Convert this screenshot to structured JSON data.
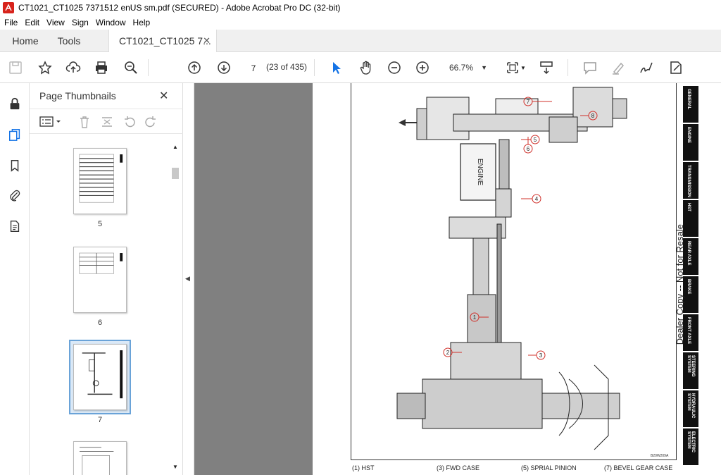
{
  "window": {
    "title": "CT1021_CT1025 7371512 enUS sm.pdf (SECURED) - Adobe Acrobat Pro DC (32-bit)"
  },
  "menu": [
    "File",
    "Edit",
    "View",
    "Sign",
    "Window",
    "Help"
  ],
  "tabs": {
    "home": "Home",
    "tools": "Tools",
    "document": "CT1021_CT1025 7...",
    "close": "✕"
  },
  "toolbar": {
    "page_number": "7",
    "page_count": "(23 of 435)",
    "zoom": "66.7%",
    "icons": [
      "save-icon",
      "bookmark-star-icon",
      "upload-icon",
      "print-icon",
      "find-icon",
      "prev-page-icon",
      "next-page-icon",
      "select-cursor-icon",
      "hand-icon",
      "zoom-out-icon",
      "zoom-in-icon",
      "page-fit-icon",
      "scroll-mode-icon",
      "comment-icon",
      "highlight-icon",
      "sign-icon",
      "fill-sign-icon"
    ]
  },
  "left_rail": {
    "icons": [
      "lock-icon",
      "pages-icon",
      "bookmark-icon",
      "attachment-icon",
      "document-icon"
    ]
  },
  "thumbnails_panel": {
    "title": "Page Thumbnails",
    "close": "✕",
    "pages": [
      "5",
      "6",
      "7"
    ]
  },
  "document_page": {
    "engine_label": "ENGINE",
    "callouts": [
      "1",
      "2",
      "3",
      "4",
      "5",
      "6",
      "7",
      "8"
    ],
    "figure_code": "B20W209A",
    "captions": [
      "(1) HST",
      "(3) FWD CASE",
      "(5) SPRIAL PINION",
      "(7) BEVEL GEAR CASE"
    ],
    "side_tabs": [
      "GENERAL",
      "ENGINE",
      "TRANSMISSION",
      "HST",
      "REAR AXLE",
      "BRAKE",
      "FRONT AXLE",
      "STEERING SYSTEM",
      "HYDRAULIC SYSTEM",
      "ELECTRIC SYSTEM"
    ],
    "watermark": "Dealer Copy -- Not for Resale"
  },
  "colors": {
    "doc_background": "#808080",
    "accent": "#1473e6",
    "callout_red": "#d0302a"
  }
}
